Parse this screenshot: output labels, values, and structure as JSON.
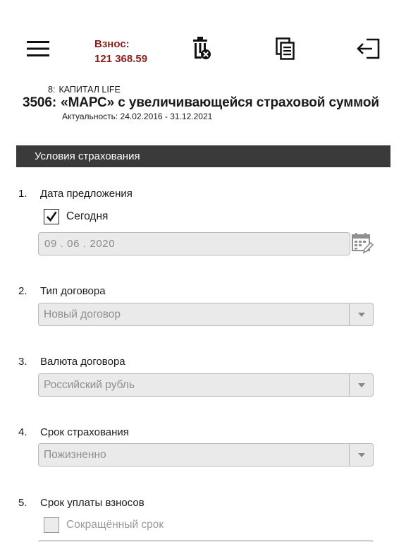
{
  "toolbar": {
    "premium_label": "Взнос:",
    "premium_value": "121 368.59",
    "icons": [
      "menu-icon",
      "trash-delete-icon",
      "copy-icon",
      "exit-icon"
    ]
  },
  "product": {
    "group_num": "8:",
    "group_name": "КАПИТАЛ LIFE",
    "code": "3506:",
    "name": "«МАРС» с увеличивающейся страховой суммой",
    "validity": "Актуальность: 24.02.2016 - 31.12.2021"
  },
  "section": {
    "title": "Условия страхования"
  },
  "questions": [
    {
      "num": "1.",
      "label": "Дата предложения",
      "checkbox_label": "Сегодня",
      "checked": true,
      "date": "09 . 06 . 2020"
    },
    {
      "num": "2.",
      "label": "Тип договора",
      "value": "Новый договор"
    },
    {
      "num": "3.",
      "label": "Валюта договора",
      "value": "Российский рубль"
    },
    {
      "num": "4.",
      "label": "Срок страхования",
      "value": "Пожизненно"
    },
    {
      "num": "5.",
      "label": "Срок уплаты взносов",
      "checkbox_label": "Сокращённый срок",
      "checked": false
    }
  ],
  "colors": {
    "accent": "#8b1c1c",
    "section_bg": "#3a3a3a",
    "field_bg": "#eaeaea"
  }
}
